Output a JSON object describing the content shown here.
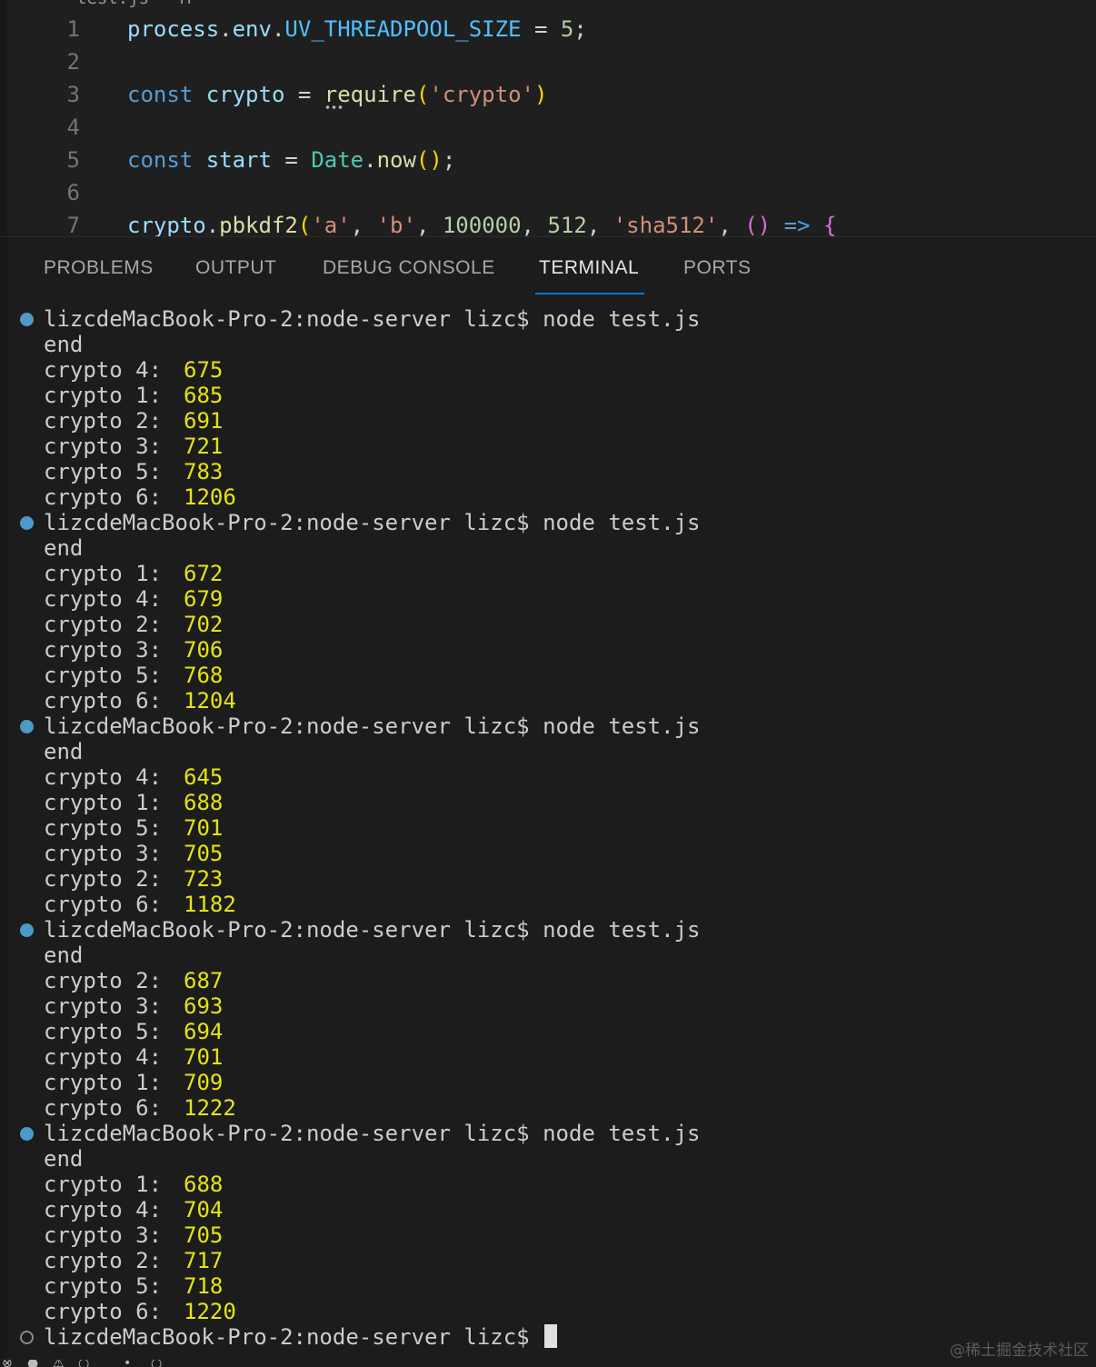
{
  "editor": {
    "tab_fragment": "test.js   M",
    "lines": [
      {
        "n": "1",
        "tokens": [
          {
            "t": "process",
            "c": "t-var"
          },
          {
            "t": ".",
            "c": "t-plain"
          },
          {
            "t": "env",
            "c": "t-var"
          },
          {
            "t": ".",
            "c": "t-plain"
          },
          {
            "t": "UV_THREADPOOL_SIZE",
            "c": "t-const"
          },
          {
            "t": " = ",
            "c": "t-plain"
          },
          {
            "t": "5",
            "c": "t-num"
          },
          {
            "t": ";",
            "c": "t-plain"
          }
        ]
      },
      {
        "n": "2",
        "tokens": []
      },
      {
        "n": "3",
        "tokens": [
          {
            "t": "const",
            "c": "t-kw"
          },
          {
            "t": " ",
            "c": "t-plain"
          },
          {
            "t": "crypto",
            "c": "t-var"
          },
          {
            "t": " = ",
            "c": "t-plain"
          },
          {
            "t": "require",
            "c": "t-fn squiggle"
          },
          {
            "t": "(",
            "c": "t-paren"
          },
          {
            "t": "'crypto'",
            "c": "t-str"
          },
          {
            "t": ")",
            "c": "t-paren"
          }
        ]
      },
      {
        "n": "4",
        "tokens": []
      },
      {
        "n": "5",
        "tokens": [
          {
            "t": "const",
            "c": "t-kw"
          },
          {
            "t": " ",
            "c": "t-plain"
          },
          {
            "t": "start",
            "c": "t-var"
          },
          {
            "t": " = ",
            "c": "t-plain"
          },
          {
            "t": "Date",
            "c": "t-type"
          },
          {
            "t": ".",
            "c": "t-plain"
          },
          {
            "t": "now",
            "c": "t-fn"
          },
          {
            "t": "()",
            "c": "t-paren"
          },
          {
            "t": ";",
            "c": "t-plain"
          }
        ]
      },
      {
        "n": "6",
        "tokens": []
      },
      {
        "n": "7",
        "tokens": [
          {
            "t": "crypto",
            "c": "t-var"
          },
          {
            "t": ".",
            "c": "t-plain"
          },
          {
            "t": "pbkdf2",
            "c": "t-fn"
          },
          {
            "t": "(",
            "c": "t-paren"
          },
          {
            "t": "'a'",
            "c": "t-str"
          },
          {
            "t": ", ",
            "c": "t-plain"
          },
          {
            "t": "'b'",
            "c": "t-str"
          },
          {
            "t": ", ",
            "c": "t-plain"
          },
          {
            "t": "100000",
            "c": "t-num"
          },
          {
            "t": ", ",
            "c": "t-plain"
          },
          {
            "t": "512",
            "c": "t-num"
          },
          {
            "t": ", ",
            "c": "t-plain"
          },
          {
            "t": "'sha512'",
            "c": "t-str"
          },
          {
            "t": ", ",
            "c": "t-plain"
          },
          {
            "t": "()",
            "c": "t-paren2"
          },
          {
            "t": " ",
            "c": "t-plain"
          },
          {
            "t": "=>",
            "c": "t-arrow"
          },
          {
            "t": " ",
            "c": "t-plain"
          },
          {
            "t": "{",
            "c": "t-paren2"
          }
        ]
      }
    ]
  },
  "panel": {
    "tabs": [
      {
        "label": "PROBLEMS",
        "active": false
      },
      {
        "label": "OUTPUT",
        "active": false
      },
      {
        "label": "DEBUG CONSOLE",
        "active": false
      },
      {
        "label": "TERMINAL",
        "active": true
      },
      {
        "label": "PORTS",
        "active": false
      }
    ]
  },
  "terminal": {
    "prompt": "lizcdeMacBook-Pro-2:node-server lizc$ ",
    "command": "node test.js",
    "end_text": "end",
    "runs": [
      {
        "results": [
          {
            "label": "crypto 4:",
            "ms": "675"
          },
          {
            "label": "crypto 1:",
            "ms": "685"
          },
          {
            "label": "crypto 2:",
            "ms": "691"
          },
          {
            "label": "crypto 3:",
            "ms": "721"
          },
          {
            "label": "crypto 5:",
            "ms": "783"
          },
          {
            "label": "crypto 6:",
            "ms": "1206"
          }
        ]
      },
      {
        "results": [
          {
            "label": "crypto 1:",
            "ms": "672"
          },
          {
            "label": "crypto 4:",
            "ms": "679"
          },
          {
            "label": "crypto 2:",
            "ms": "702"
          },
          {
            "label": "crypto 3:",
            "ms": "706"
          },
          {
            "label": "crypto 5:",
            "ms": "768"
          },
          {
            "label": "crypto 6:",
            "ms": "1204"
          }
        ]
      },
      {
        "results": [
          {
            "label": "crypto 4:",
            "ms": "645"
          },
          {
            "label": "crypto 1:",
            "ms": "688"
          },
          {
            "label": "crypto 5:",
            "ms": "701"
          },
          {
            "label": "crypto 3:",
            "ms": "705"
          },
          {
            "label": "crypto 2:",
            "ms": "723"
          },
          {
            "label": "crypto 6:",
            "ms": "1182"
          }
        ]
      },
      {
        "results": [
          {
            "label": "crypto 2:",
            "ms": "687"
          },
          {
            "label": "crypto 3:",
            "ms": "693"
          },
          {
            "label": "crypto 5:",
            "ms": "694"
          },
          {
            "label": "crypto 4:",
            "ms": "701"
          },
          {
            "label": "crypto 1:",
            "ms": "709"
          },
          {
            "label": "crypto 6:",
            "ms": "1222"
          }
        ]
      },
      {
        "results": [
          {
            "label": "crypto 1:",
            "ms": "688"
          },
          {
            "label": "crypto 4:",
            "ms": "704"
          },
          {
            "label": "crypto 3:",
            "ms": "705"
          },
          {
            "label": "crypto 2:",
            "ms": "717"
          },
          {
            "label": "crypto 5:",
            "ms": "718"
          },
          {
            "label": "crypto 6:",
            "ms": "1220"
          }
        ]
      }
    ],
    "final_prompt": "lizcdeMacBook-Pro-2:node-server lizc$ "
  },
  "watermark": "@稀土掘金技术社区",
  "colors": {
    "accent": "#0078d4",
    "result_value": "#e5e510",
    "prompt_dot": "#4d9ac6"
  }
}
